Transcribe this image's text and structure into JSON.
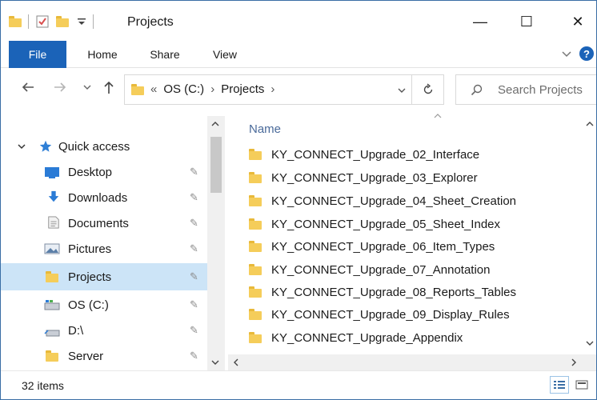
{
  "window": {
    "title": "Projects",
    "controls": {
      "minimize": "—",
      "maximize": "☐",
      "close": "✕"
    }
  },
  "ribbon": {
    "tabs": [
      "File",
      "Home",
      "Share",
      "View"
    ]
  },
  "address": {
    "prefix": "«",
    "segments": [
      "OS (C:)",
      "Projects"
    ],
    "separator": "›"
  },
  "search": {
    "placeholder": "Search Projects"
  },
  "nav": {
    "quick_access": "Quick access",
    "items": [
      {
        "label": "Desktop",
        "icon": "desktop-icon",
        "pinned": true
      },
      {
        "label": "Downloads",
        "icon": "download-icon",
        "pinned": true
      },
      {
        "label": "Documents",
        "icon": "documents-icon",
        "pinned": true
      },
      {
        "label": "Pictures",
        "icon": "pictures-icon",
        "pinned": true
      },
      {
        "label": "Projects",
        "icon": "folder-icon",
        "pinned": true,
        "selected": true
      },
      {
        "label": "OS (C:)",
        "icon": "drive-icon",
        "pinned": true
      },
      {
        "label": "D:\\",
        "icon": "drive-icon",
        "pinned": true
      },
      {
        "label": "Server",
        "icon": "folder-icon",
        "pinned": true
      }
    ]
  },
  "content": {
    "column_name": "Name",
    "files": [
      "KY_CONNECT_Upgrade_02_Interface",
      "KY_CONNECT_Upgrade_03_Explorer",
      "KY_CONNECT_Upgrade_04_Sheet_Creation",
      "KY_CONNECT_Upgrade_05_Sheet_Index",
      "KY_CONNECT_Upgrade_06_Item_Types",
      "KY_CONNECT_Upgrade_07_Annotation",
      "KY_CONNECT_Upgrade_08_Reports_Tables",
      "KY_CONNECT_Upgrade_09_Display_Rules",
      "KY_CONNECT_Upgrade_Appendix"
    ]
  },
  "status": {
    "item_count": "32 items"
  },
  "colors": {
    "accent": "#1b63b8",
    "selection": "#cce4f7",
    "folder": "#f5cd5a"
  }
}
